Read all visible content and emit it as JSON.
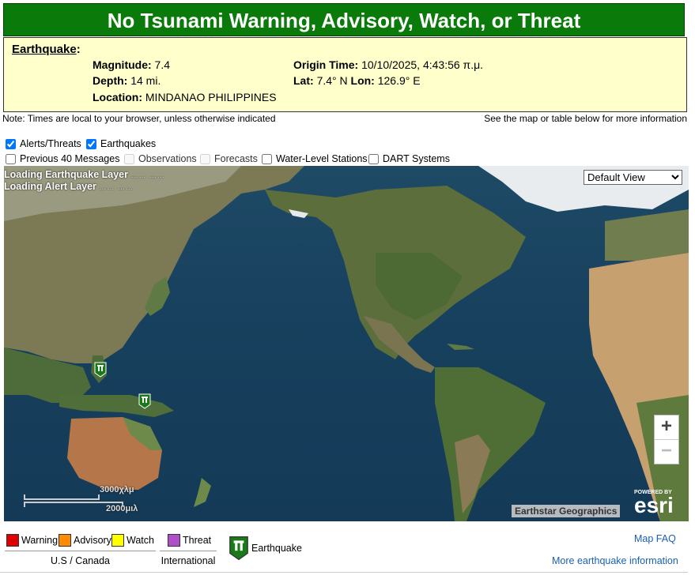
{
  "banner": {
    "text": "No Tsunami Warning, Advisory, Watch, or Threat",
    "color": "#0a7a0a"
  },
  "earthquake": {
    "heading": "Earthquake",
    "magnitude_label": "Magnitude:",
    "magnitude": "7.4",
    "depth_label": "Depth:",
    "depth": "14 mi.",
    "location_label": "Location:",
    "location": "MINDANAO PHILIPPINES",
    "origin_label": "Origin Time:",
    "origin": "10/10/2025, 4:43:56 π.μ.",
    "lat_label": "Lat:",
    "lat": "7.4° N",
    "lon_label": "Lon:",
    "lon": "126.9° E"
  },
  "notes": {
    "left": "Note: Times are local to your browser, unless otherwise indicated",
    "right": "See the map or table below for more information"
  },
  "layers": {
    "alerts": {
      "label": "Alerts/Threats",
      "checked": true
    },
    "earthquakes": {
      "label": "Earthquakes",
      "checked": true
    },
    "previous": {
      "label": "Previous 40 Messages",
      "checked": false
    },
    "observations": {
      "label": "Observations",
      "checked": false,
      "disabled": true
    },
    "forecasts": {
      "label": "Forecasts",
      "checked": false,
      "disabled": true
    },
    "water": {
      "label": "Water-Level Stations",
      "checked": false
    },
    "dart": {
      "label": "DART Systems",
      "checked": false
    }
  },
  "map": {
    "loading_eq": "Loading Earthquake Layer",
    "loading_alert": "Loading Alert Layer",
    "view_options": [
      "Default View"
    ],
    "view_selected": "Default View",
    "zoom_in": "+",
    "zoom_out": "−",
    "attribution": "Earthstar Geographics",
    "powered_by": "POWERED BY",
    "esri": "esri",
    "scale_km": "3000χλμ",
    "scale_mi": "2000μιλ"
  },
  "legend": {
    "warning": {
      "label": "Warning",
      "color": "#e00000"
    },
    "advisory": {
      "label": "Advisory",
      "color": "#ff8c00"
    },
    "watch": {
      "label": "Watch",
      "color": "#ffff00"
    },
    "threat": {
      "label": "Threat",
      "color": "#b04fc8"
    },
    "us_canada": "U.S / Canada",
    "international": "International",
    "earthquake": "Earthquake"
  },
  "links": {
    "faq": "Map FAQ",
    "more": "More earthquake information"
  }
}
